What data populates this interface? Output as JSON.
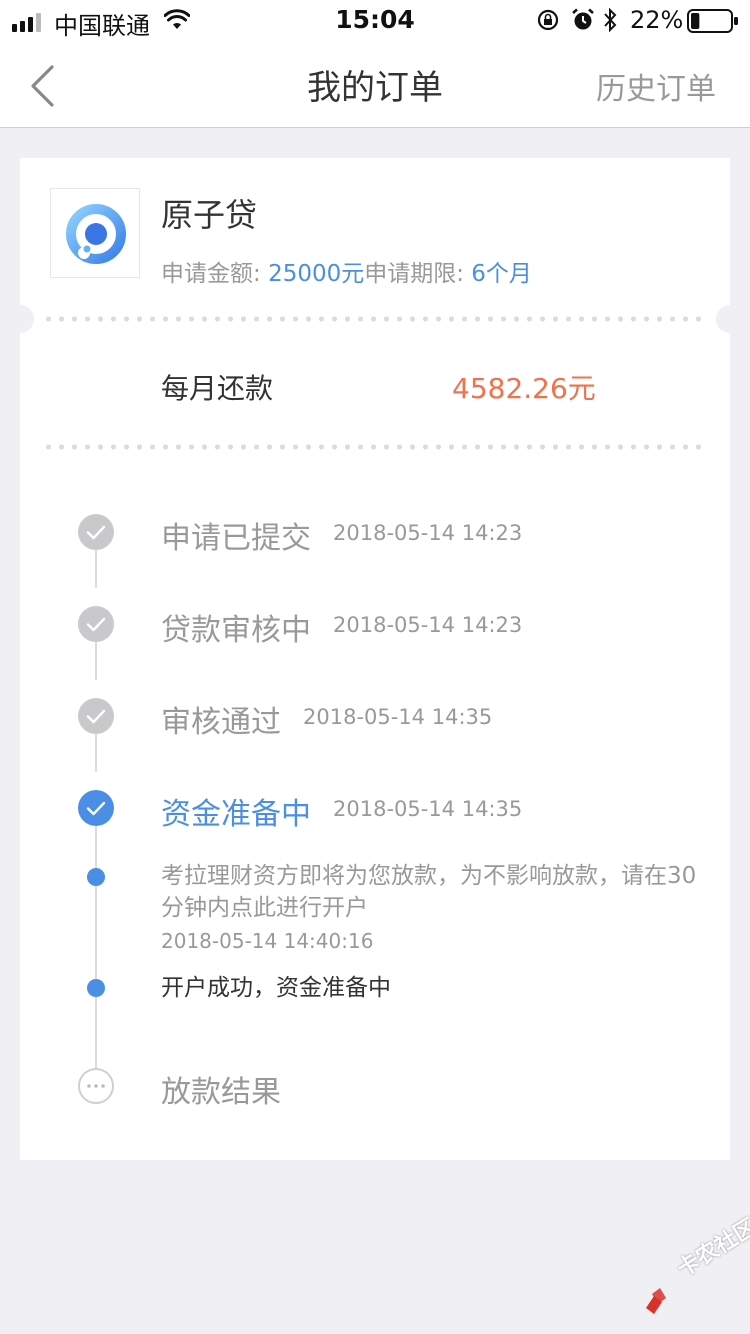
{
  "status_bar": {
    "carrier": "中国联通",
    "time": "15:04",
    "battery_percent": "22%",
    "battery_level": 0.22
  },
  "nav": {
    "title": "我的订单",
    "history_label": "历史订单"
  },
  "order": {
    "product_name": "原子贷",
    "amount_label": "申请金额:",
    "amount_value": "25000元",
    "term_label": "申请期限:",
    "term_value": "6个月",
    "monthly_label": "每月还款",
    "monthly_amount": "4582.26元"
  },
  "timeline": {
    "steps": [
      {
        "title": "申请已提交",
        "time": "2018-05-14 14:23",
        "state": "done"
      },
      {
        "title": "贷款审核中",
        "time": "2018-05-14 14:23",
        "state": "done"
      },
      {
        "title": "审核通过",
        "time": "2018-05-14 14:35",
        "state": "done"
      },
      {
        "title": "资金准备中",
        "time": "2018-05-14 14:35",
        "state": "active"
      },
      {
        "title": "放款结果",
        "time": "",
        "state": "pending"
      }
    ],
    "sub_events": [
      {
        "text": "考拉理财资方即将为您放款，为不影响放款，请在30分钟内点此进行开户",
        "time": "2018-05-14 14:40:16"
      },
      {
        "text": "开户成功，资金准备中",
        "time": ""
      }
    ]
  },
  "watermark": {
    "text": "卡农社区"
  },
  "colors": {
    "accent": "#4a8ee6",
    "amount": "#f0714c",
    "done_icon": "#c9c9cc",
    "background": "#efeff4"
  }
}
